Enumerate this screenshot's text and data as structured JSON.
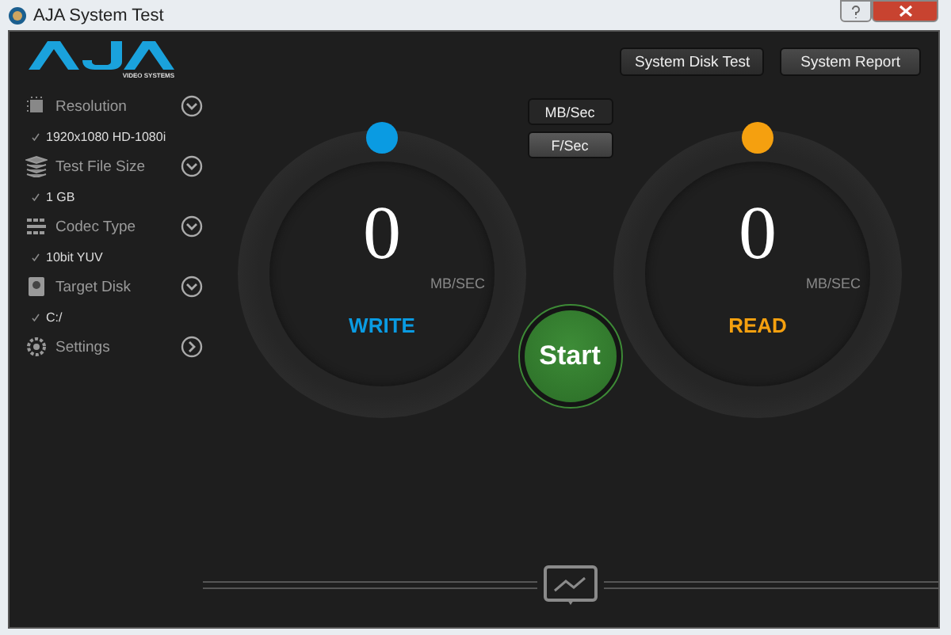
{
  "window": {
    "title": "AJA System Test"
  },
  "logo": {
    "tagline": "VIDEO SYSTEMS"
  },
  "sidebar": {
    "items": [
      {
        "kind": "dropdown",
        "label": "Resolution",
        "value": "1920x1080 HD-1080i"
      },
      {
        "kind": "dropdown",
        "label": "Test File Size",
        "value": "1 GB"
      },
      {
        "kind": "dropdown",
        "label": "Codec Type",
        "value": "10bit YUV"
      },
      {
        "kind": "dropdown",
        "label": "Target Disk",
        "value": "C:/"
      },
      {
        "kind": "link",
        "label": "Settings"
      }
    ]
  },
  "top_buttons": [
    "System Disk Test",
    "System Report"
  ],
  "units": [
    {
      "label": "MB/Sec",
      "selected": true
    },
    {
      "label": "F/Sec",
      "selected": false
    }
  ],
  "gauges": [
    {
      "value": "0",
      "unit": "MB/SEC",
      "label": "WRITE",
      "color": "#0a9be2"
    },
    {
      "value": "0",
      "unit": "MB/SEC",
      "label": "READ",
      "color": "#f5a00f"
    }
  ],
  "start_button": "Start"
}
